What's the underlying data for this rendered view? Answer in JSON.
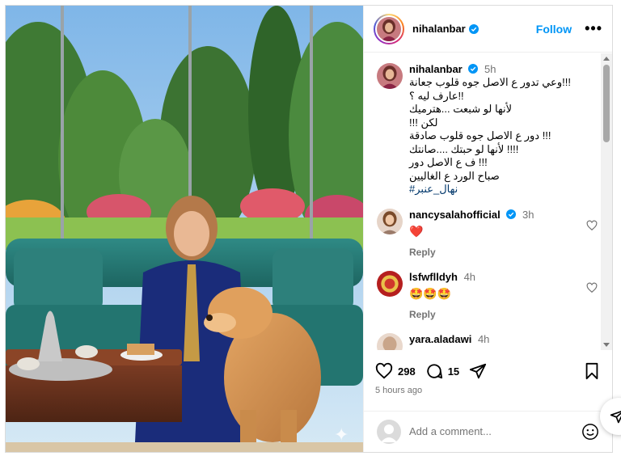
{
  "post": {
    "username": "nihalanbar",
    "follow_label": "Follow",
    "more_label": "•••"
  },
  "caption": {
    "username": "nihalanbar",
    "time": "5h",
    "lines": [
      "!!!وعي تدور ع الاصل جوه قلوب جعانة",
      "!!عارف ليه ؟",
      "لأنها لو شبعت ...هترميك",
      "لكن !!!",
      "!!! دور ع الاصل جوه  قلوب صادقة",
      "!!!! لأنها لو حبتك ....صانتك",
      "!!! ف ع الاصل دور",
      "صباح الورد ع الغاليين"
    ],
    "hashtag": "#نهال_عنبر"
  },
  "comments": [
    {
      "username": "nancysalahofficial",
      "verified": true,
      "time": "3h",
      "text": "❤️",
      "reply_label": "Reply"
    },
    {
      "username": "lsfwflldyh",
      "verified": false,
      "time": "4h",
      "text": "🤩🤩🤩",
      "reply_label": "Reply"
    },
    {
      "username": "yara.aladawi",
      "verified": false,
      "time": "4h",
      "text": "",
      "reply_label": ""
    }
  ],
  "actions": {
    "likes": "298",
    "comments": "15",
    "posted_ago": "5 hours ago"
  },
  "add_comment": {
    "placeholder": "Add a comment..."
  },
  "icons": {
    "verified": "verified-badge-icon",
    "like": "heart-icon",
    "comment": "comment-bubble-icon",
    "share": "paper-plane-icon",
    "save": "bookmark-icon",
    "emoji": "smiley-icon",
    "more": "more-dots-icon",
    "message": "paper-plane-icon"
  },
  "colors": {
    "accent": "#0095f6",
    "verified": "#0095f6",
    "like_heart": "#ed4956",
    "muted": "#737373"
  }
}
